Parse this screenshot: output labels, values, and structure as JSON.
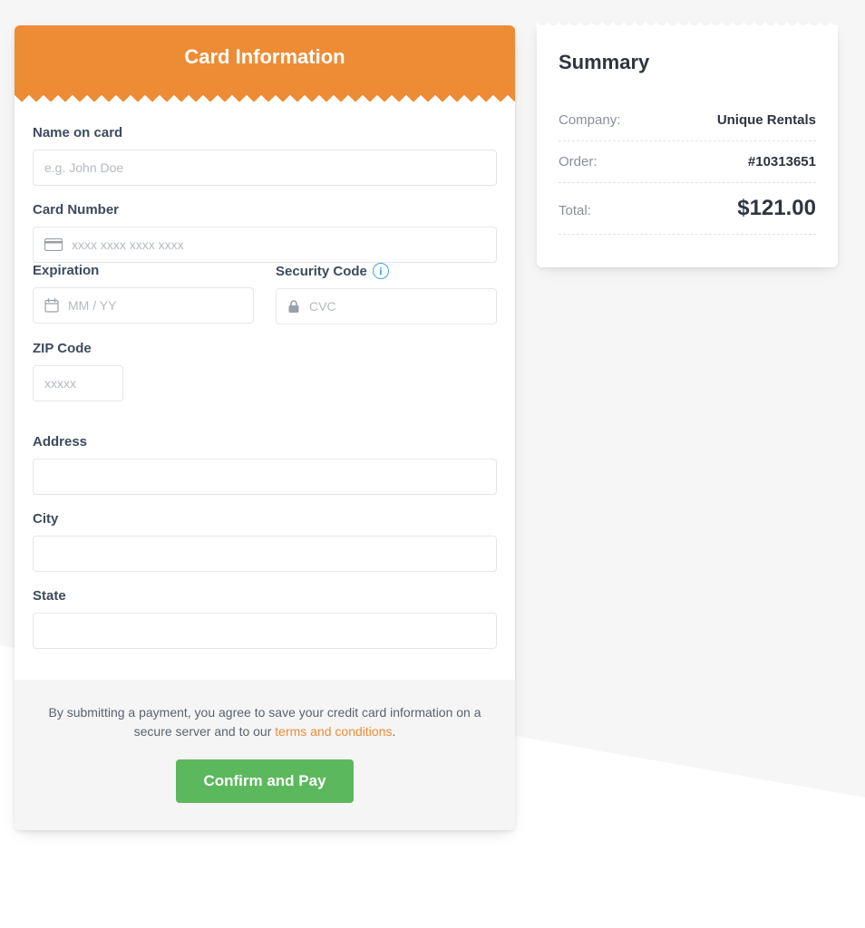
{
  "card": {
    "heading": "Card Information",
    "name_label": "Name on card",
    "name_placeholder": "e.g. John Doe",
    "number_label": "Card Number",
    "number_placeholder": "xxxx xxxx xxxx xxxx",
    "expiration_label": "Expiration",
    "expiration_placeholder": "MM / YY",
    "security_label": "Security Code",
    "security_placeholder": "CVC",
    "zip_label": "ZIP Code",
    "zip_placeholder": "xxxxx",
    "address_label": "Address",
    "city_label": "City",
    "state_label": "State"
  },
  "footer": {
    "disclaimer_pre": "By submitting a payment, you agree to save your credit card information on a secure server and to our ",
    "terms_link": "terms and conditions",
    "disclaimer_post": ".",
    "confirm_label": "Confirm and Pay"
  },
  "summary": {
    "heading": "Summary",
    "company_label": "Company:",
    "company_value": "Unique Rentals",
    "order_label": "Order:",
    "order_value": "#10313651",
    "total_label": "Total:",
    "total_value": "$121.00"
  }
}
